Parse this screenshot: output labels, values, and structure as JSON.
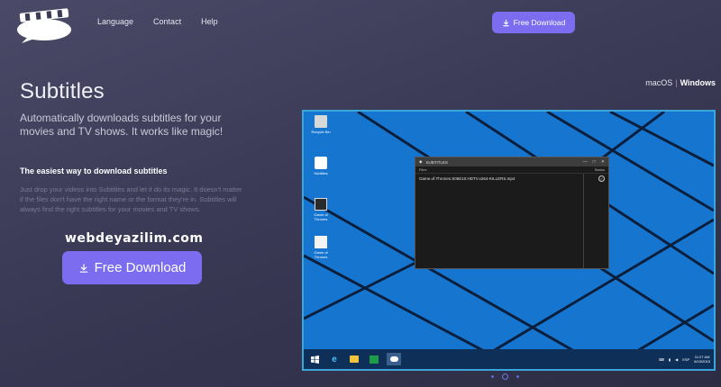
{
  "header": {
    "nav": [
      "Language",
      "Contact",
      "Help"
    ],
    "download_label": "Free Download"
  },
  "hero": {
    "title": "Subtitles",
    "tagline": "Automatically downloads subtitles for your movies and TV shows. It works like magic!",
    "subheading": "The easiest way to download subtitles",
    "description": "Just drop your videos into Subtitles and let it do its magic. It doesn't matter if the files don't have the right name or the format they're in. Subtitles will always find the right subtitles for your movies and TV shows.",
    "download_label": "Free Download"
  },
  "watermark": "webdeyazilim.com",
  "os_switch": {
    "mac": "macOS",
    "separator": "|",
    "windows": "Windows"
  },
  "screenshot": {
    "desktop_icons": [
      "Recycle Bin",
      "Subtitles",
      "Game of Thrones",
      "Game of Thrones"
    ],
    "app": {
      "title": "SUBTITLES",
      "col_files": "Files",
      "col_status": "Status",
      "file_name": "Game.of.Thrones.S05E10.HDTV.x264-KILLERS.mp4"
    },
    "taskbar": {
      "lang": "ESP",
      "time": "11:27 AM",
      "date": "6/15/2015"
    }
  },
  "carousel": {
    "count": 3,
    "active": 2
  },
  "colors": {
    "accent": "#7b6cf0",
    "background": "#3a3a56",
    "desktop": "#1270c8"
  }
}
